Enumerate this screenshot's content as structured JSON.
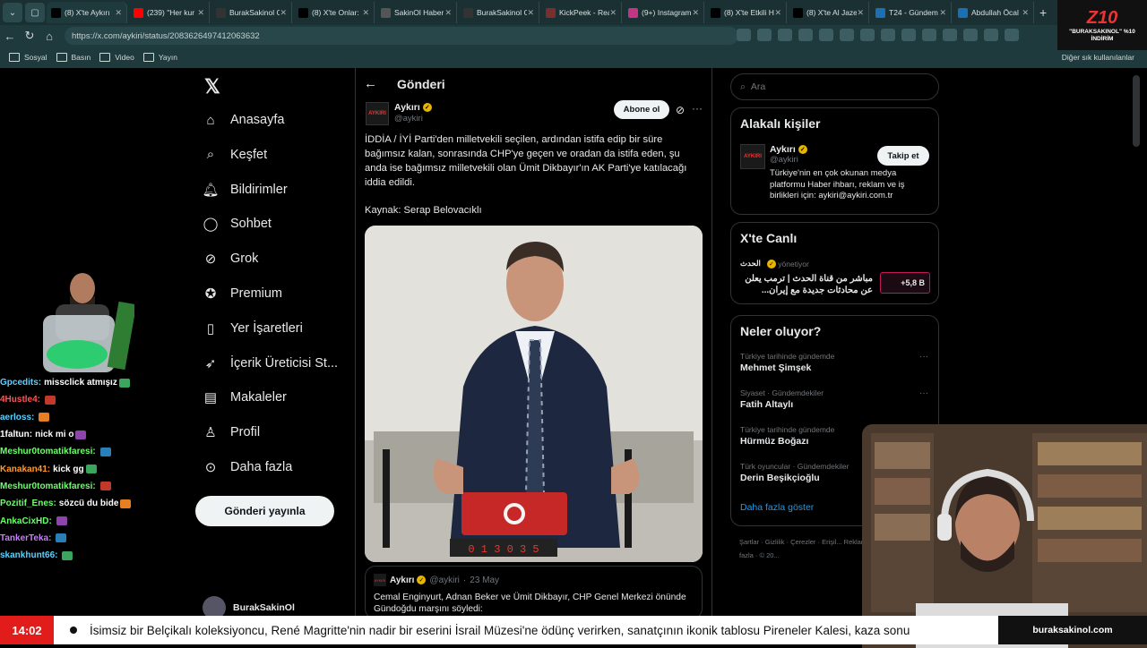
{
  "browser": {
    "tabs": [
      {
        "label": "(8) X'te Aykırı",
        "color": "#000000",
        "active": true
      },
      {
        "label": "(239) \"Her kur",
        "color": "#ff0000"
      },
      {
        "label": "BurakSakinol G",
        "color": "#333333"
      },
      {
        "label": "(8) X'te Onlar:",
        "color": "#000000"
      },
      {
        "label": "SakinOl Haber",
        "color": "#555555"
      },
      {
        "label": "BurakSakinol G",
        "color": "#333333"
      },
      {
        "label": "KickPeek - Rea",
        "color": "#7a2e2e"
      },
      {
        "label": "(9+) Instagram",
        "color": "#c13584"
      },
      {
        "label": "(8) X'te Etkili H",
        "color": "#000000"
      },
      {
        "label": "(8) X'te Al Jaze",
        "color": "#000000"
      },
      {
        "label": "T24 - Gündem",
        "color": "#1a6fb5"
      },
      {
        "label": "Abdullah Öcal",
        "color": "#1a6fb5"
      }
    ],
    "url": "https://x.com/aykiri/status/2083626497412063632",
    "bookmarks": [
      "Sosyal",
      "Basın",
      "Video",
      "Yayın"
    ],
    "other_bookmarks": "Diğer sık kullanılanlar"
  },
  "overlay_brand": {
    "logo": "Z10",
    "text": "\"BURAKSAKINOL\" %10 İNDİRİM"
  },
  "nav": {
    "items": [
      {
        "label": "Anasayfa",
        "icon": "home-icon"
      },
      {
        "label": "Keşfet",
        "icon": "search-icon"
      },
      {
        "label": "Bildirimler",
        "icon": "bell-icon"
      },
      {
        "label": "Sohbet",
        "icon": "chat-icon"
      },
      {
        "label": "Grok",
        "icon": "grok-icon"
      },
      {
        "label": "Premium",
        "icon": "premium-icon"
      },
      {
        "label": "Yer İşaretleri",
        "icon": "bookmark-icon"
      },
      {
        "label": "İçerik Üreticisi St...",
        "icon": "rocket-icon"
      },
      {
        "label": "Makaleler",
        "icon": "article-icon"
      },
      {
        "label": "Profil",
        "icon": "profile-icon"
      },
      {
        "label": "Daha fazla",
        "icon": "more-icon"
      }
    ],
    "post_button": "Gönderi yayınla",
    "account_name": "BurakSakinOl"
  },
  "main": {
    "header": "Gönderi",
    "author_name": "Aykırı",
    "author_handle": "@aykiri",
    "subscribe": "Abone ol",
    "text": "İDDİA / İYİ Parti'den milletvekili seçilen, ardından istifa edip bir süre bağımsız kalan, sonrasında CHP'ye geçen ve oradan da istifa eden, şu anda ise bağımsız milletvekili olan Ümit Dikbayır'ın AK Parti'ye katılacağı iddia edildi.",
    "source": "Kaynak: Serap Belovacıklı",
    "clock_display": "0 1 3 0 3 5",
    "quote": {
      "name": "Aykırı",
      "handle": "@aykiri",
      "date": "23 May",
      "text": "Cemal Enginyurt, Adnan Beker ve Ümit Dikbayır, CHP Genel Merkezi önünde Gündoğdu marşını söyledi:"
    }
  },
  "right": {
    "search_placeholder": "Ara",
    "related_title": "Alakalı kişiler",
    "related": {
      "name": "Aykırı",
      "handle": "@aykiri",
      "bio": "Türkiye'nin en çok okunan medya platformu Haber ihbarı, reklam ve iş birlikleri için: aykiri@aykiri.com.tr",
      "follow": "Takip et"
    },
    "live_title": "X'te Canlı",
    "live": {
      "channel": "الحدث",
      "role": "yönetiyor",
      "text": "مباشر من قناة الحدث | ترمب يعلن عن محادثات جديدة مع إيران...",
      "count": "+5,8 B"
    },
    "trends_title": "Neler oluyor?",
    "trends": [
      {
        "context": "Türkiye tarihinde gündemde",
        "topic": "Mehmet Şimşek"
      },
      {
        "context": "Siyaset · Gündemdekiler",
        "topic": "Fatih Altaylı"
      },
      {
        "context": "Türkiye tarihinde gündemde",
        "topic": "Hürmüz Boğazı"
      },
      {
        "context": "Türk oyuncular · Gündemdekiler",
        "topic": "Derin Beşikçioğlu"
      }
    ],
    "show_more": "Daha fazla göster",
    "footer": "Şartlar · Gizlilik · Çerezler · Erişil... Reklam Bilgileri · Daha fazla · © 20..."
  },
  "chat": [
    {
      "user": "Gpcedits:",
      "msg": "missclick atmışız",
      "color": "#5bd1ff"
    },
    {
      "user": "4Hustle4:",
      "msg": "",
      "color": "#ff5555"
    },
    {
      "user": "aerloss:",
      "msg": "",
      "color": "#5bd1ff"
    },
    {
      "user": "1faltun:",
      "msg": "nick mi o",
      "color": "#ffffff"
    },
    {
      "user": "Meshur0tomatikfaresi:",
      "msg": "",
      "color": "#6cff6c"
    },
    {
      "user": "Kanakan41:",
      "msg": "kick gg",
      "color": "#ff9a2e"
    },
    {
      "user": "Meshur0tomatikfaresi:",
      "msg": "",
      "color": "#6cff6c"
    },
    {
      "user": "Pozitif_Enes:",
      "msg": "sözcü du bide",
      "color": "#6cff6c"
    },
    {
      "user": "AnkaCixHD:",
      "msg": "",
      "color": "#6cff6c"
    },
    {
      "user": "TankerTeka:",
      "msg": "",
      "color": "#c77dff"
    },
    {
      "user": "skankhunt66:",
      "msg": "",
      "color": "#5bd1ff"
    }
  ],
  "ticker": {
    "time": "14:02",
    "text": "İsimsiz bir Belçikalı koleksiyoncu, René Magritte'nin nadir bir eserini İsrail Müzesi'ne ödünç verirken, sanatçının ikonik tablosu Pireneler Kalesi, kaza sonu",
    "site": "buraksakinol.com"
  }
}
